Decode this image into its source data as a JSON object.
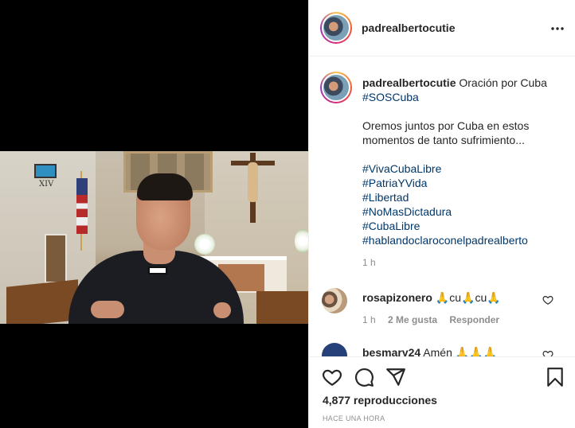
{
  "post": {
    "username": "padrealbertocutie",
    "more_icon": "more-horizontal-icon"
  },
  "caption": {
    "username": "padrealbertocutie",
    "title": "Oración por Cuba",
    "first_tag": "#SOSCuba",
    "body": "Oremos juntos por Cuba en estos momentos de tanto sufrimiento...",
    "hashtags": [
      "#VivaCubaLibre",
      "#PatriaYVida",
      "#Libertad",
      "#NoMasDictadura",
      "#CubaLibre",
      "#hablandoclaroconelpadrealberto"
    ],
    "time": "1 h"
  },
  "comments": [
    {
      "username": "rosapizonero",
      "text": "🙏cu🙏cu🙏",
      "time": "1 h",
      "likes": "2 Me gusta",
      "reply": "Responder"
    },
    {
      "username": "besmary24",
      "text": "Amén 🙏🙏🙏"
    }
  ],
  "actions": {
    "like_icon": "heart-icon",
    "comment_icon": "comment-icon",
    "share_icon": "send-icon",
    "save_icon": "bookmark-icon"
  },
  "stats": {
    "views": "4,877 reproducciones",
    "posted": "HACE UNA HORA"
  },
  "video": {
    "wall_numeral": "XIV"
  }
}
